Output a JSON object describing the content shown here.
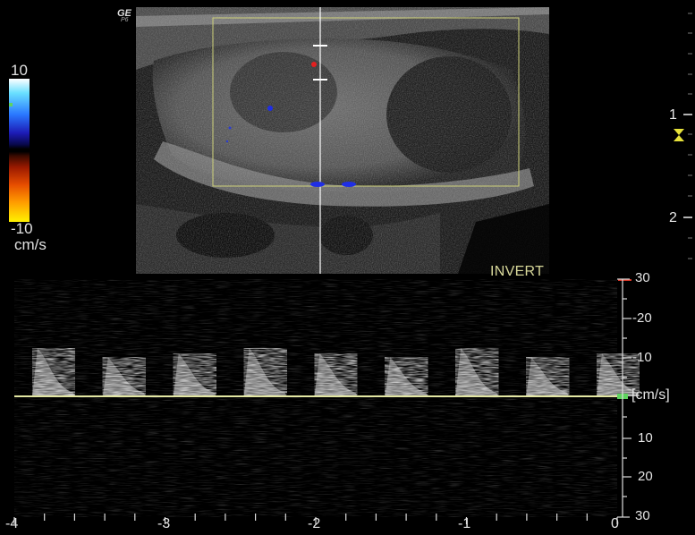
{
  "brand": {
    "logo": "GE",
    "probe": "P6"
  },
  "color_scale": {
    "top": "10",
    "bottom": "-10",
    "unit": "cm/s"
  },
  "invert_label": "INVERT",
  "depth_scale": {
    "labels": [
      "1",
      "2"
    ]
  },
  "spectral_velocity_axis": {
    "labels": [
      "30",
      "-20",
      "-10",
      "[cm/s]",
      "10",
      "20",
      "30"
    ]
  },
  "time_axis": {
    "labels": [
      "-4",
      "-3",
      "-2",
      "-1",
      "0"
    ]
  },
  "spectral_waveform": {
    "peaks": 9,
    "baseline_color": "#dfe69a"
  },
  "colors": {
    "roi_box": "#cfd27a",
    "baseline": "#e2e6a2",
    "cursor": "#ffffff"
  },
  "icons": [
    "focus-marker-icon",
    "sample-volume-icon"
  ]
}
